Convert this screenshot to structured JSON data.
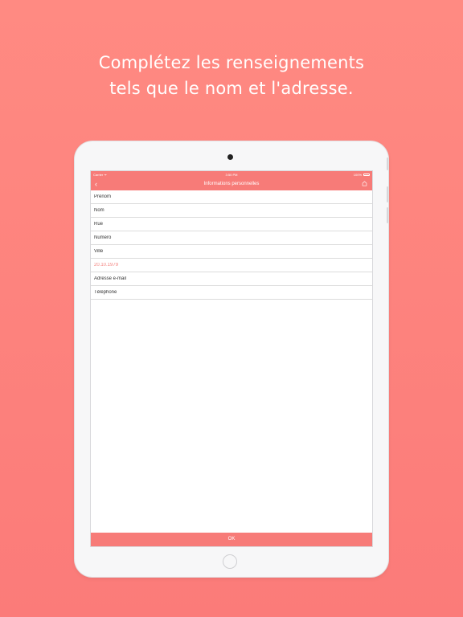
{
  "headline": {
    "line1": "Complétez les renseignements",
    "line2": "tels que le nom et l'adresse."
  },
  "status_bar": {
    "carrier": "Carrier ᯤ",
    "time": "3:50 PM",
    "battery": "100%"
  },
  "nav_bar": {
    "back_icon": "‹",
    "title": "Informations personnelles"
  },
  "form": {
    "fields": [
      {
        "placeholder": "Prénom"
      },
      {
        "placeholder": "Nom"
      },
      {
        "placeholder": "Rue"
      },
      {
        "placeholder": "Numéro"
      },
      {
        "placeholder": "Ville"
      },
      {
        "placeholder": "20.10.1979"
      },
      {
        "placeholder": "Adresse e-mail"
      },
      {
        "placeholder": "Téléphone"
      }
    ]
  },
  "ok_button": {
    "label": "OK"
  },
  "colors": {
    "accent": "#f77b78",
    "background": "#ff8a82",
    "date_text": "#f4837f"
  }
}
